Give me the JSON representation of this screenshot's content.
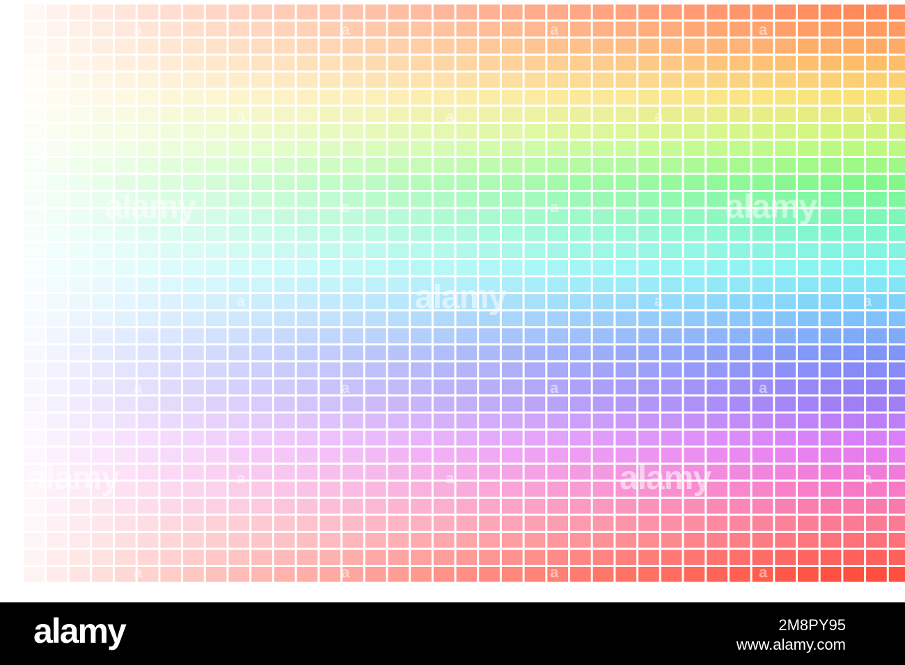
{
  "image": {
    "subject": "mosaic",
    "palette": {
      "fade_color": "#ffffff",
      "grout_color": "#ffffff",
      "rainbow_stops": [
        "#ff8a5c",
        "#ffb468",
        "#f9e37a",
        "#c5fa7f",
        "#7ef88c",
        "#7ff6c8",
        "#86f3f6",
        "#7fc6fa",
        "#7f8ef8",
        "#9c7ff6",
        "#e37ffa",
        "#f77ac8",
        "#fc7a88",
        "#ff4f3f"
      ]
    },
    "watermarks": {
      "word": "alamy",
      "letter": "a"
    }
  },
  "footer": {
    "logo": "alamy",
    "image_id": "2M8PY95",
    "url": "www.alamy.com",
    "background": "#000000",
    "text_color": "#ffffff"
  }
}
